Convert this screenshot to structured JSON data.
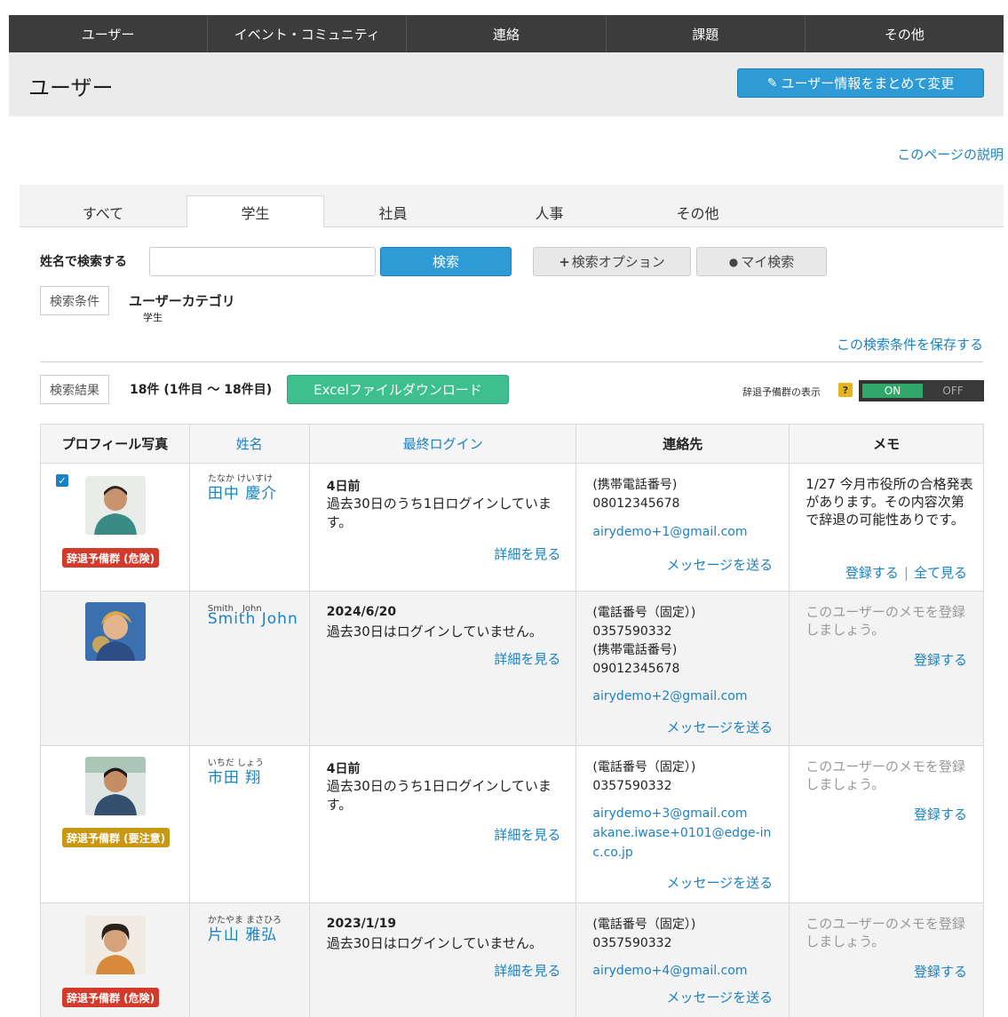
{
  "nav": [
    "ユーザー",
    "イベント・コミュニティ",
    "連絡",
    "課題",
    "その他"
  ],
  "header": {
    "title": "ユーザー",
    "bulk_edit": "ユーザー情報をまとめて変更"
  },
  "page_help": "このページの説明",
  "tabs": [
    "すべて",
    "学生",
    "社員",
    "人事",
    "その他"
  ],
  "active_tab": "学生",
  "search": {
    "label": "姓名で検索する",
    "placeholder": "",
    "button": "検索",
    "options": "検索オプション",
    "my_search": "マイ検索"
  },
  "conditions": {
    "box_label": "検索条件",
    "category_label": "ユーザーカテゴリ",
    "category_value": "学生",
    "save": "この検索条件を保存する"
  },
  "results": {
    "box_label": "検索結果",
    "count": "18件 (1件目 ～ 18件目)",
    "excel": "Excelファイルダウンロード",
    "decline_label": "辞退予備群の表示",
    "help": "?",
    "toggle_on": "ON",
    "toggle_off": "OFF"
  },
  "table": {
    "headers": [
      "プロフィール写真",
      "姓名",
      "最終ログイン",
      "連絡先",
      "メモ"
    ],
    "rows": [
      {
        "kana": "たなか けいすけ",
        "name": "田中 慶介",
        "badge": "辞退予備群 (危険)",
        "login_date": "4日前",
        "login_desc": "過去30日のうち1日ログインしています。",
        "details": "詳細を見る",
        "contact": [
          "(携帯電話番号)",
          "08012345678"
        ],
        "emails": [
          "airydemo+1@gmail.com"
        ],
        "message": "メッセージを送る",
        "memo": "1/27 今月市役所の合格発表があります。その内容次第で辞退の可能性ありです。",
        "memo_register": "登録する",
        "memo_all": "全て見る"
      },
      {
        "kana": "Smith　John",
        "name": "Smith John",
        "badge": "",
        "login_date": "2024/6/20",
        "login_desc": "過去30日はログインしていません。",
        "details": "詳細を見る",
        "contact": [
          "(電話番号（固定）)",
          "0357590332",
          "(携帯電話番号)",
          "09012345678"
        ],
        "emails": [
          "airydemo+2@gmail.com"
        ],
        "message": "メッセージを送る",
        "memo": "このユーザーのメモを登録しましょう。",
        "memo_register": "登録する"
      },
      {
        "kana": "いちだ しょう",
        "name": "市田 翔",
        "badge": "辞退予備群 (要注意)",
        "login_date": "4日前",
        "login_desc": "過去30日のうち1日ログインしています。",
        "details": "詳細を見る",
        "contact": [
          "(電話番号（固定）)",
          "0357590332"
        ],
        "emails": [
          "airydemo+3@gmail.com",
          "akane.iwase+0101@edge-inc.co.jp"
        ],
        "message": "メッセージを送る",
        "memo": "このユーザーのメモを登録しましょう。",
        "memo_register": "登録する"
      },
      {
        "kana": "かたやま まさひろ",
        "name": "片山 雅弘",
        "badge": "辞退予備群 (危険)",
        "login_date": "2023/1/19",
        "login_desc": "過去30日はログインしていません。",
        "details": "詳細を見る",
        "contact": [
          "(電話番号（固定）)",
          "0357590332"
        ],
        "emails": [
          "airydemo+4@gmail.com"
        ],
        "message": "メッセージを送る",
        "memo": "このユーザーのメモを登録しましょう。",
        "memo_register": "登録する"
      }
    ]
  },
  "colors": {
    "nav_bg": "#3c3c3c",
    "primary": "#2f9bd6",
    "link": "#1a82c4",
    "excel": "#3dbf8e",
    "danger": "#d23a2b",
    "caution": "#c99712"
  }
}
